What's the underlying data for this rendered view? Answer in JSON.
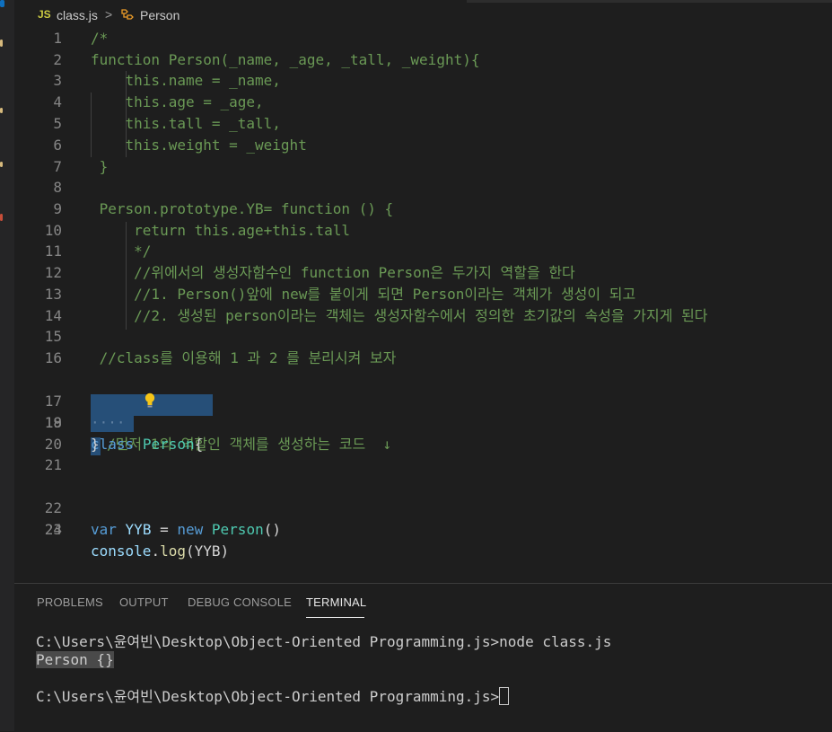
{
  "breadcrumb": {
    "lang_badge": "JS",
    "file": "class.js",
    "separator": ">",
    "symbol": "Person",
    "symbol_icon": "class-symbol-icon"
  },
  "editor": {
    "lines": [
      {
        "n": "1",
        "text": "/*"
      },
      {
        "n": "2",
        "text": "function Person(_name, _age, _tall, _weight){"
      },
      {
        "n": "3",
        "text": "    this.name = _name,"
      },
      {
        "n": "4",
        "text": "    this.age = _age,"
      },
      {
        "n": "5",
        "text": "    this.tall = _tall,"
      },
      {
        "n": "6",
        "text": "    this.weight = _weight"
      },
      {
        "n": "7",
        "text": " }"
      },
      {
        "n": "8",
        "text": ""
      },
      {
        "n": "9",
        "text": " Person.prototype.YB= function () {"
      },
      {
        "n": "10",
        "text": "     return this.age+this.tall"
      },
      {
        "n": "11",
        "text": "     */"
      },
      {
        "n": "12",
        "text": "     //위에서의 생성자함수인 function Person은 두가지 역할을 한다"
      },
      {
        "n": "13",
        "text": "     //1. Person()앞에 new를 붙이게 되면 Person이라는 객체가 생성이 되고"
      },
      {
        "n": "14",
        "text": "     //2. 생성된 person이라는 객체는 생성자함수에서 정의한 초기값의 속성을 가지게 된다"
      },
      {
        "n": "15",
        "text": ""
      },
      {
        "n": "16",
        "text": " //class를 이용해 1 과 2 를 분리시켜 보자"
      },
      {
        "n": "17",
        "text": "/먼저 1의 역할인 객체를 생성하는 코드  ↓"
      },
      {
        "n": "18",
        "text": "class Person{"
      },
      {
        "n": "19",
        "text": "····"
      },
      {
        "n": "20",
        "text": "}"
      },
      {
        "n": "21",
        "text": ""
      },
      {
        "n": "22",
        "text": ""
      },
      {
        "n": "23",
        "text": ""
      },
      {
        "n": "24",
        "text": ""
      }
    ],
    "lightbulb_icon": "lightbulb-icon",
    "line22": {
      "kw": "var",
      "id": "YYB",
      "op": " = ",
      "new": "new",
      "cls": "Person",
      "tail": "()"
    },
    "line23": {
      "obj": "console",
      "dot": ".",
      "fn": "log",
      "arg": "(YYB)"
    }
  },
  "panel": {
    "tabs": [
      "PROBLEMS",
      "OUTPUT",
      "DEBUG CONSOLE",
      "TERMINAL"
    ],
    "active_tab": "TERMINAL",
    "terminal": {
      "cmd1": "C:\\Users\\윤여빈\\Desktop\\Object-Oriented Programming.js>node class.js",
      "out1": "Person {}",
      "prompt2": "C:\\Users\\윤여빈\\Desktop\\Object-Oriented Programming.js>"
    }
  },
  "colors": {
    "comment": "#6a9955",
    "keyword": "#569cd6",
    "variable": "#9cdcfe",
    "class": "#4ec9b0",
    "function": "#dcdcaa",
    "selection": "#264f78"
  }
}
